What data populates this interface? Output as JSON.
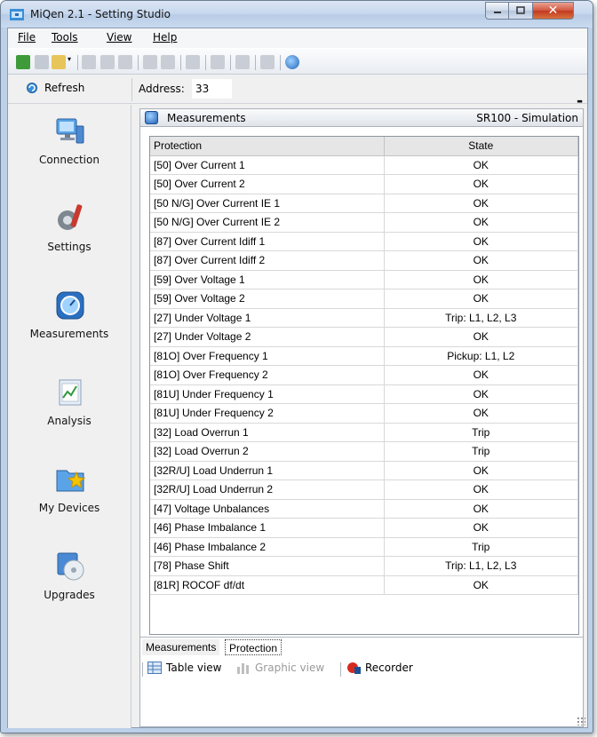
{
  "window": {
    "title": "MiQen 2.1 - Setting Studio"
  },
  "menu": [
    {
      "label": "File"
    },
    {
      "label": "Tools"
    },
    {
      "label": "View"
    },
    {
      "label": "Help"
    }
  ],
  "toolbar": {
    "icons": [
      "new-icon",
      "print-setup-icon",
      "open-icon",
      "dropdown-icon",
      "save-icon",
      "save-as-icon",
      "copy-icon",
      "print-icon",
      "print-preview-icon",
      "chart-icon",
      "tag-icon",
      "monitor-icon",
      "tools-icon",
      "settings-icon"
    ]
  },
  "addressbar": {
    "refresh_label": "Refresh",
    "address_label": "Address:",
    "address_value": "33"
  },
  "sidebar": {
    "items": [
      {
        "label": "Connection",
        "icon": "computer-network-icon"
      },
      {
        "label": "Settings",
        "icon": "gear-wrench-icon"
      },
      {
        "label": "Measurements",
        "icon": "gauge-icon"
      },
      {
        "label": "Analysis",
        "icon": "chart-analysis-icon"
      },
      {
        "label": "My Devices",
        "icon": "folder-star-icon"
      },
      {
        "label": "Upgrades",
        "icon": "disc-upgrade-icon"
      }
    ]
  },
  "panel": {
    "title": "Measurements",
    "device": "SR100 - Simulation",
    "table": {
      "headers": [
        "Protection",
        "State"
      ],
      "rows": [
        [
          "[50] Over Current 1",
          "OK"
        ],
        [
          "[50] Over Current 2",
          "OK"
        ],
        [
          "[50 N/G] Over Current IE 1",
          "OK"
        ],
        [
          "[50 N/G] Over Current IE 2",
          "OK"
        ],
        [
          "[87] Over Current Idiff 1",
          "OK"
        ],
        [
          "[87] Over Current Idiff 2",
          "OK"
        ],
        [
          "[59] Over Voltage 1",
          "OK"
        ],
        [
          "[59] Over Voltage 2",
          "OK"
        ],
        [
          "[27] Under Voltage 1",
          "Trip: L1, L2, L3"
        ],
        [
          "[27] Under Voltage 2",
          "OK"
        ],
        [
          "[81O] Over Frequency 1",
          "Pickup: L1, L2"
        ],
        [
          "[81O] Over Frequency 2",
          "OK"
        ],
        [
          "[81U] Under Frequency 1",
          "OK"
        ],
        [
          "[81U] Under Frequency 2",
          "OK"
        ],
        [
          "[32] Load Overrun 1",
          "Trip"
        ],
        [
          "[32] Load Overrun 2",
          "Trip"
        ],
        [
          "[32R/U] Load Underrun 1",
          "OK"
        ],
        [
          "[32R/U] Load Underrun 2",
          "OK"
        ],
        [
          "[47] Voltage Unbalances",
          "OK"
        ],
        [
          "[46] Phase Imbalance 1",
          "OK"
        ],
        [
          "[46] Phase Imbalance 2",
          "Trip"
        ],
        [
          "[78] Phase Shift",
          "Trip: L1, L2, L3"
        ],
        [
          "[81R] ROCOF df/dt",
          "OK"
        ]
      ]
    },
    "tabs": [
      {
        "label": "Measurements",
        "active": false
      },
      {
        "label": "Protection",
        "active": true
      }
    ],
    "view": {
      "table_view": "Table view",
      "graphic_view": "Graphic view",
      "recorder": "Recorder"
    }
  }
}
